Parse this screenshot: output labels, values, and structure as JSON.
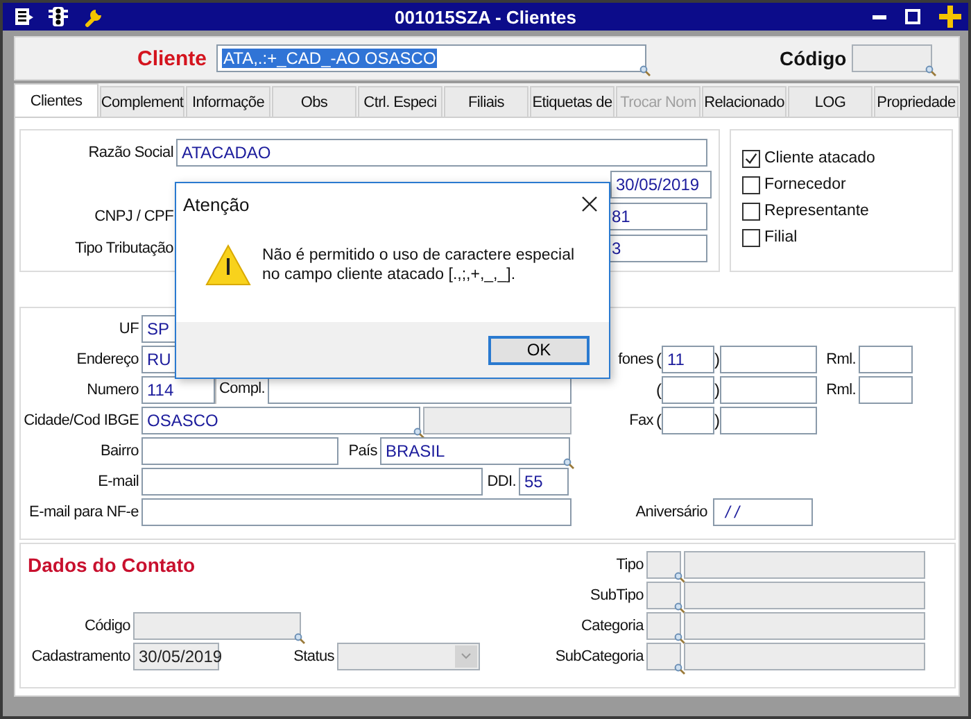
{
  "window": {
    "title": "001015SZA - Clientes"
  },
  "header": {
    "cliente_label": "Cliente",
    "cliente_value": "ATA,.:+_CAD_-AO OSASCO",
    "cliente_value_selected": true,
    "codigo_label": "Código"
  },
  "tabs": [
    {
      "label": "Clientes",
      "selected": true,
      "disabled": false
    },
    {
      "label": "Complement",
      "selected": false,
      "disabled": false
    },
    {
      "label": "Informaçõe",
      "selected": false,
      "disabled": false
    },
    {
      "label": "Obs",
      "selected": false,
      "disabled": false
    },
    {
      "label": "Ctrl. Especi",
      "selected": false,
      "disabled": false
    },
    {
      "label": "Filiais",
      "selected": false,
      "disabled": false
    },
    {
      "label": "Etiquetas de",
      "selected": false,
      "disabled": false
    },
    {
      "label": "Trocar Nom",
      "selected": false,
      "disabled": true
    },
    {
      "label": "Relacionado",
      "selected": false,
      "disabled": false
    },
    {
      "label": "LOG",
      "selected": false,
      "disabled": false
    },
    {
      "label": "Propriedade",
      "selected": false,
      "disabled": false
    }
  ],
  "main": {
    "razao_social": {
      "label": "Razão Social",
      "value": "ATACADAO"
    },
    "date_value": "30/05/2019",
    "cnpj": {
      "label": "CNPJ / CPF",
      "value": "81"
    },
    "tributacao": {
      "label": "Tipo Tributação",
      "value": "3"
    }
  },
  "flags": [
    {
      "label": "Cliente atacado",
      "checked": true
    },
    {
      "label": "Fornecedor",
      "checked": false
    },
    {
      "label": "Representante",
      "checked": false
    },
    {
      "label": "Filial",
      "checked": false
    }
  ],
  "address": {
    "uf": {
      "label": "UF",
      "value": "SP"
    },
    "endereco": {
      "label": "Endereço",
      "value": "RU"
    },
    "numero": {
      "label": "Numero",
      "value": "114"
    },
    "compl_label": "Compl.",
    "cidade": {
      "label": "Cidade/Cod IBGE",
      "value": "OSASCO"
    },
    "bairro_label": "Bairro",
    "pais": {
      "label": "País",
      "value": "BRASIL"
    },
    "email_label": "E-mail",
    "ddi": {
      "label": "DDI.",
      "value": "55"
    },
    "email_nfe_label": "E-mail para NF-e",
    "phones": [
      {
        "label": "fones",
        "open": "(",
        "area": "11",
        "close": ")",
        "rml": "Rml."
      },
      {
        "open": "(",
        "close": ")",
        "rml": "Rml."
      }
    ],
    "fax": {
      "label": "Fax",
      "open": "(",
      "close": ")"
    },
    "aniversario": {
      "label": "Aniversário",
      "value": "/ /"
    }
  },
  "contact": {
    "title": "Dados do Contato",
    "codigo_label": "Código",
    "cadastramento": {
      "label": "Cadastramento",
      "value": "30/05/2019"
    },
    "status_label": "Status",
    "classes": [
      {
        "label": "Tipo"
      },
      {
        "label": "SubTipo"
      },
      {
        "label": "Categoria"
      },
      {
        "label": "SubCategoria"
      }
    ]
  },
  "dialog": {
    "title": "Atenção",
    "message": "Não é permitido o uso de caractere especial\nno campo cliente atacado [.,;,+,_,_].",
    "button": "OK"
  }
}
